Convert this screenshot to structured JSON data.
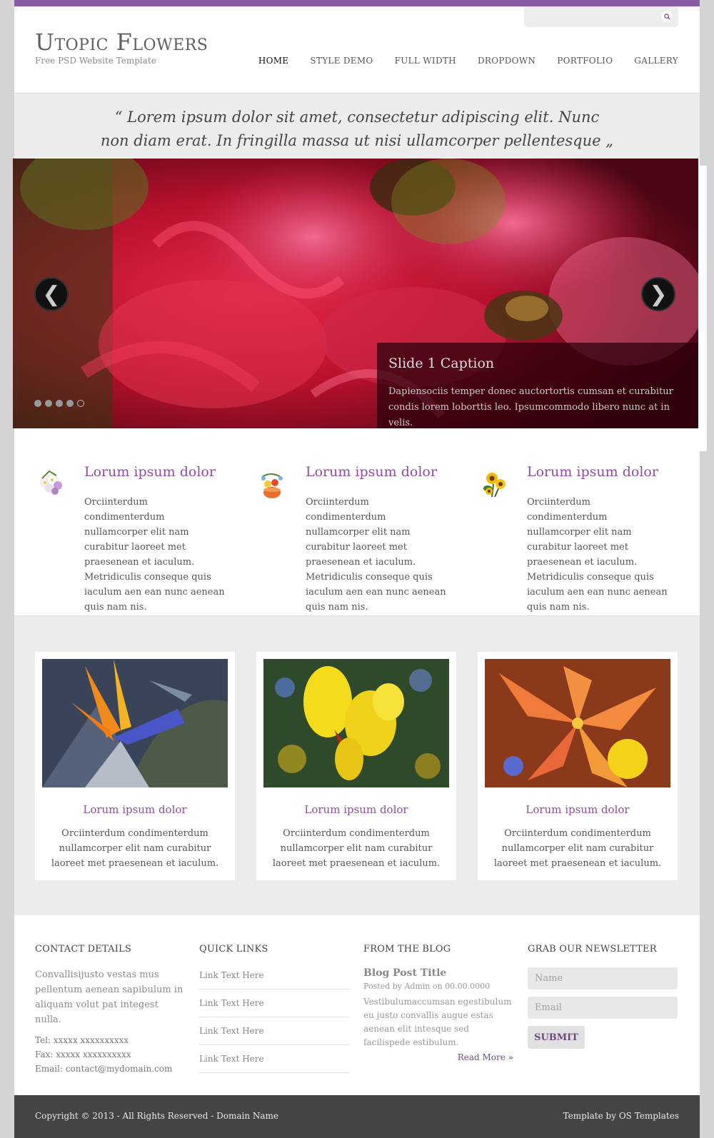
{
  "header": {
    "logo": "Utopic Flowers",
    "tagline": "Free PSD Website Template",
    "search_placeholder": ""
  },
  "nav": {
    "items": [
      "HOME",
      "STYLE DEMO",
      "FULL WIDTH",
      "DROPDOWN",
      "PORTFOLIO",
      "GALLERY"
    ],
    "active_index": 0
  },
  "quote": {
    "text": "“ Lorem ipsum dolor sit amet, consectetur adipiscing elit. Nunc non diam erat. In fringilla massa ut nisi ullamcorper pellentesque „"
  },
  "slider": {
    "prev_glyph": "❮",
    "next_glyph": "❯",
    "caption_title": "Slide 1 Caption",
    "caption_text": "Dapiensociis temper donec auctortortis cumsan et curabitur condis lorem loborttis leo. Ipsumcommodo libero nunc at in velis.",
    "slide_count": 5,
    "active_slide": 4
  },
  "features": [
    {
      "icon": "flower-bouquet-icon",
      "title": "Lorum ipsum dolor",
      "text": "Orciinterdum condimenterdum nullamcorper elit nam curabitur laoreet met praesenean et iaculum. Metridiculis conseque quis iaculum aen ean nunc aenean quis nam nis."
    },
    {
      "icon": "fruit-basket-icon",
      "title": "Lorum ipsum dolor",
      "text": "Orciinterdum condimenterdum nullamcorper elit nam curabitur laoreet met praesenean et iaculum. Metridiculis conseque quis iaculum aen ean nunc aenean quis nam nis."
    },
    {
      "icon": "sunflower-icon",
      "title": "Lorum ipsum dolor",
      "text": "Orciinterdum condimenterdum nullamcorper elit nam curabitur laoreet met praesenean et iaculum. Metridiculis conseque quis iaculum aen ean nunc aenean quis nam nis."
    }
  ],
  "gallery": [
    {
      "image": "bird-of-paradise-photo",
      "title": "Lorum ipsum dolor",
      "text": "Orciinterdum condimenterdum nullamcorper elit nam curabitur laoreet met praesenean et iaculum."
    },
    {
      "image": "yellow-flower-photo",
      "title": "Lorum ipsum dolor",
      "text": "Orciinterdum condimenterdum nullamcorper elit nam curabitur laoreet met praesenean et iaculum."
    },
    {
      "image": "orange-lily-photo",
      "title": "Lorum ipsum dolor",
      "text": "Orciinterdum condimenterdum nullamcorper elit nam curabitur laoreet met praesenean et iaculum."
    }
  ],
  "footer": {
    "contact": {
      "heading": "CONTACT DETAILS",
      "desc": "Convallisijusto vestas mus pellentum aenean sapibulum in aliquam volut pat integest nulla.",
      "tel": "Tel: xxxxx xxxxxxxxxx",
      "fax": "Fax: xxxxx xxxxxxxxxx",
      "email": "Email: contact@mydomain.com"
    },
    "quick_links": {
      "heading": "QUICK LINKS",
      "links": [
        "Link Text Here",
        "Link Text Here",
        "Link Text Here",
        "Link Text Here"
      ]
    },
    "blog": {
      "heading": "FROM THE BLOG",
      "post_title": "Blog Post Title",
      "meta": "Posted by Admin on 00.00.0000",
      "excerpt": "Vestibulumaccumsan egestibulum eu justo convallis augue estas aenean elit intesque sed facilispede estibulum.",
      "read_more": "Read More »"
    },
    "newsletter": {
      "heading": "GRAB OUR NEWSLETTER",
      "name_placeholder": "Name",
      "email_placeholder": "Email",
      "submit": "SUBMIT"
    }
  },
  "bottom_bar": {
    "copyright": "Copyright © 2013 - All Rights Reserved - Domain Name",
    "credit": "Template by OS Templates"
  },
  "colors": {
    "accent": "#8b5aa6",
    "heading_purple": "#8e4d9e",
    "bottom_bar": "#444444"
  }
}
